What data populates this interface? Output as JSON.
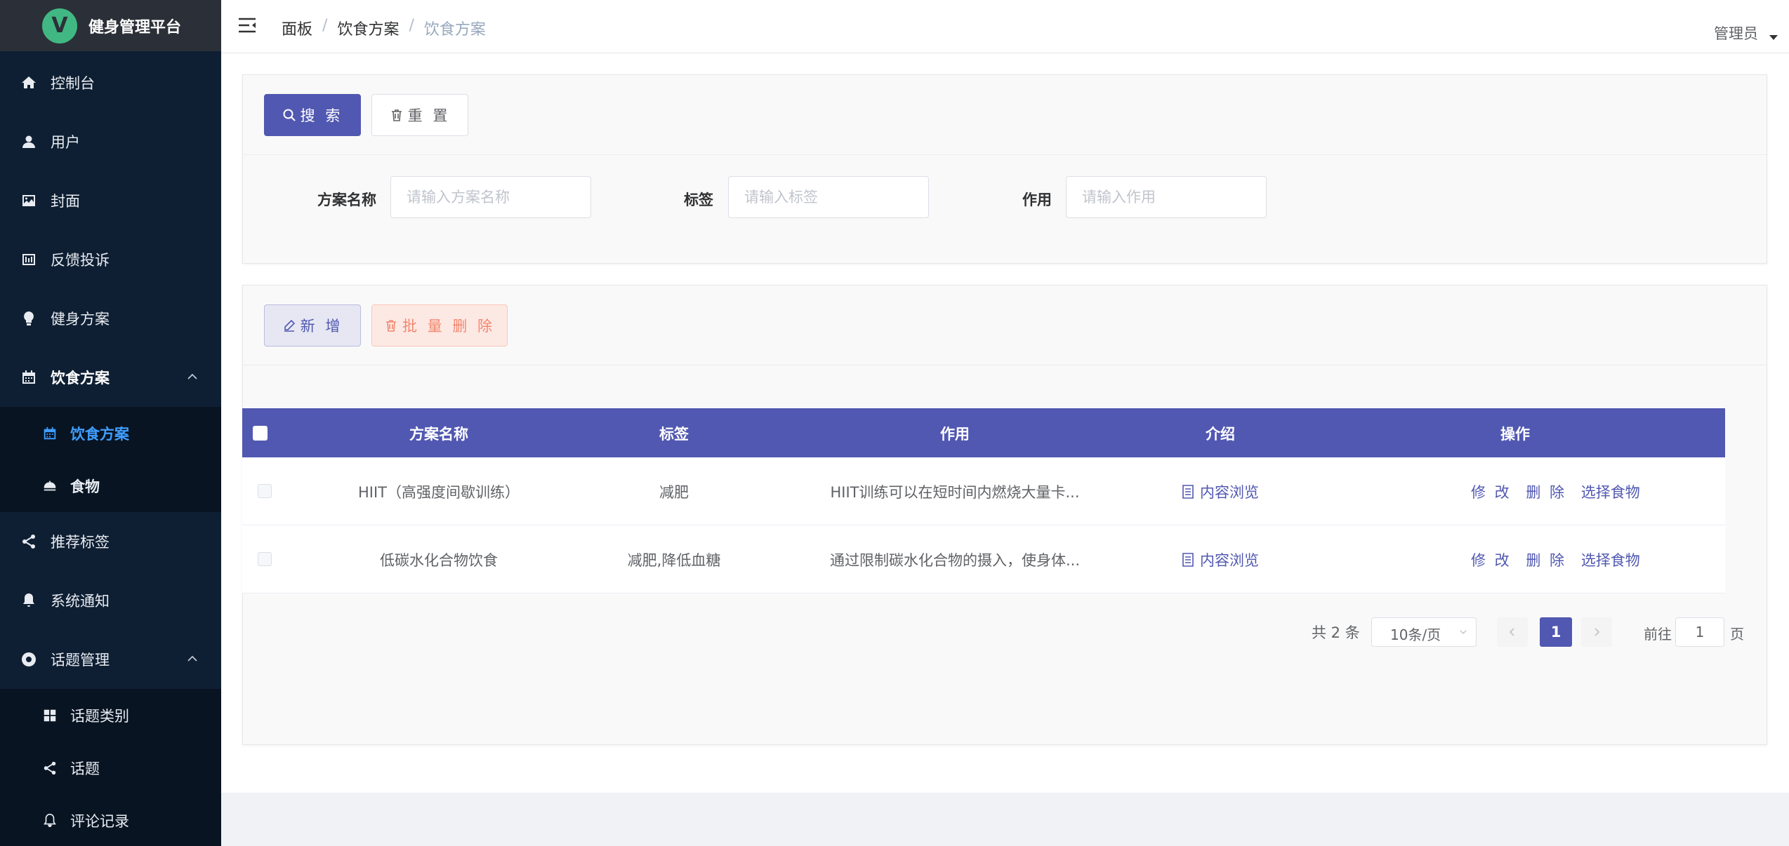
{
  "app": {
    "logo_letter": "V",
    "title": "健身管理平台"
  },
  "sidebar": {
    "items": [
      {
        "label": "控制台",
        "icon": "home-icon"
      },
      {
        "label": "用户",
        "icon": "user-icon"
      },
      {
        "label": "封面",
        "icon": "image-icon"
      },
      {
        "label": "反馈投诉",
        "icon": "feedback-icon"
      },
      {
        "label": "健身方案",
        "icon": "bulb-icon"
      },
      {
        "label": "饮食方案",
        "icon": "calendar-icon"
      },
      {
        "label": "推荐标签",
        "icon": "share-icon"
      },
      {
        "label": "系统通知",
        "icon": "bell-icon"
      },
      {
        "label": "话题管理",
        "icon": "lifebuoy-icon"
      }
    ],
    "diet_sub": [
      {
        "label": "饮食方案",
        "icon": "calendar-icon"
      },
      {
        "label": "食物",
        "icon": "dish-icon"
      }
    ],
    "topic_sub": [
      {
        "label": "话题类别",
        "icon": "grid-icon"
      },
      {
        "label": "话题",
        "icon": "share-icon"
      },
      {
        "label": "评论记录",
        "icon": "bell-icon"
      }
    ]
  },
  "header": {
    "breadcrumb": [
      "面板",
      "饮食方案",
      "饮食方案"
    ],
    "separator": "/",
    "user": "管理员"
  },
  "search": {
    "search_label": "搜 索",
    "reset_label": "重 置",
    "fields": [
      {
        "label": "方案名称",
        "placeholder": "请输入方案名称"
      },
      {
        "label": "标签",
        "placeholder": "请输入标签"
      },
      {
        "label": "作用",
        "placeholder": "请输入作用"
      }
    ]
  },
  "toolbar": {
    "add_label": "新 增",
    "batch_delete_label": "批 量 删 除"
  },
  "table": {
    "columns": [
      "方案名称",
      "标签",
      "作用",
      "介绍",
      "操作"
    ],
    "rows": [
      {
        "name": "HIIT（高强度间歇训练）",
        "tags": "减肥",
        "effect": "HIIT训练可以在短时间内燃烧大量卡...",
        "intro": "内容浏览"
      },
      {
        "name": "低碳水化合物饮食",
        "tags": "减肥,降低血糖",
        "effect": "通过限制碳水化合物的摄入，使身体...",
        "intro": "内容浏览"
      }
    ],
    "actions": {
      "edit": "修 改",
      "delete": "删 除",
      "select_food": "选择食物"
    }
  },
  "pagination": {
    "total": "共 2 条",
    "page_size": "10条/页",
    "current": "1",
    "goto_prefix": "前往",
    "goto_value": "1",
    "goto_suffix": "页"
  },
  "colors": {
    "primary": "#5158b1",
    "sidebar": "#0f1f33",
    "active_link": "#409eff",
    "danger": "#f2876e"
  }
}
